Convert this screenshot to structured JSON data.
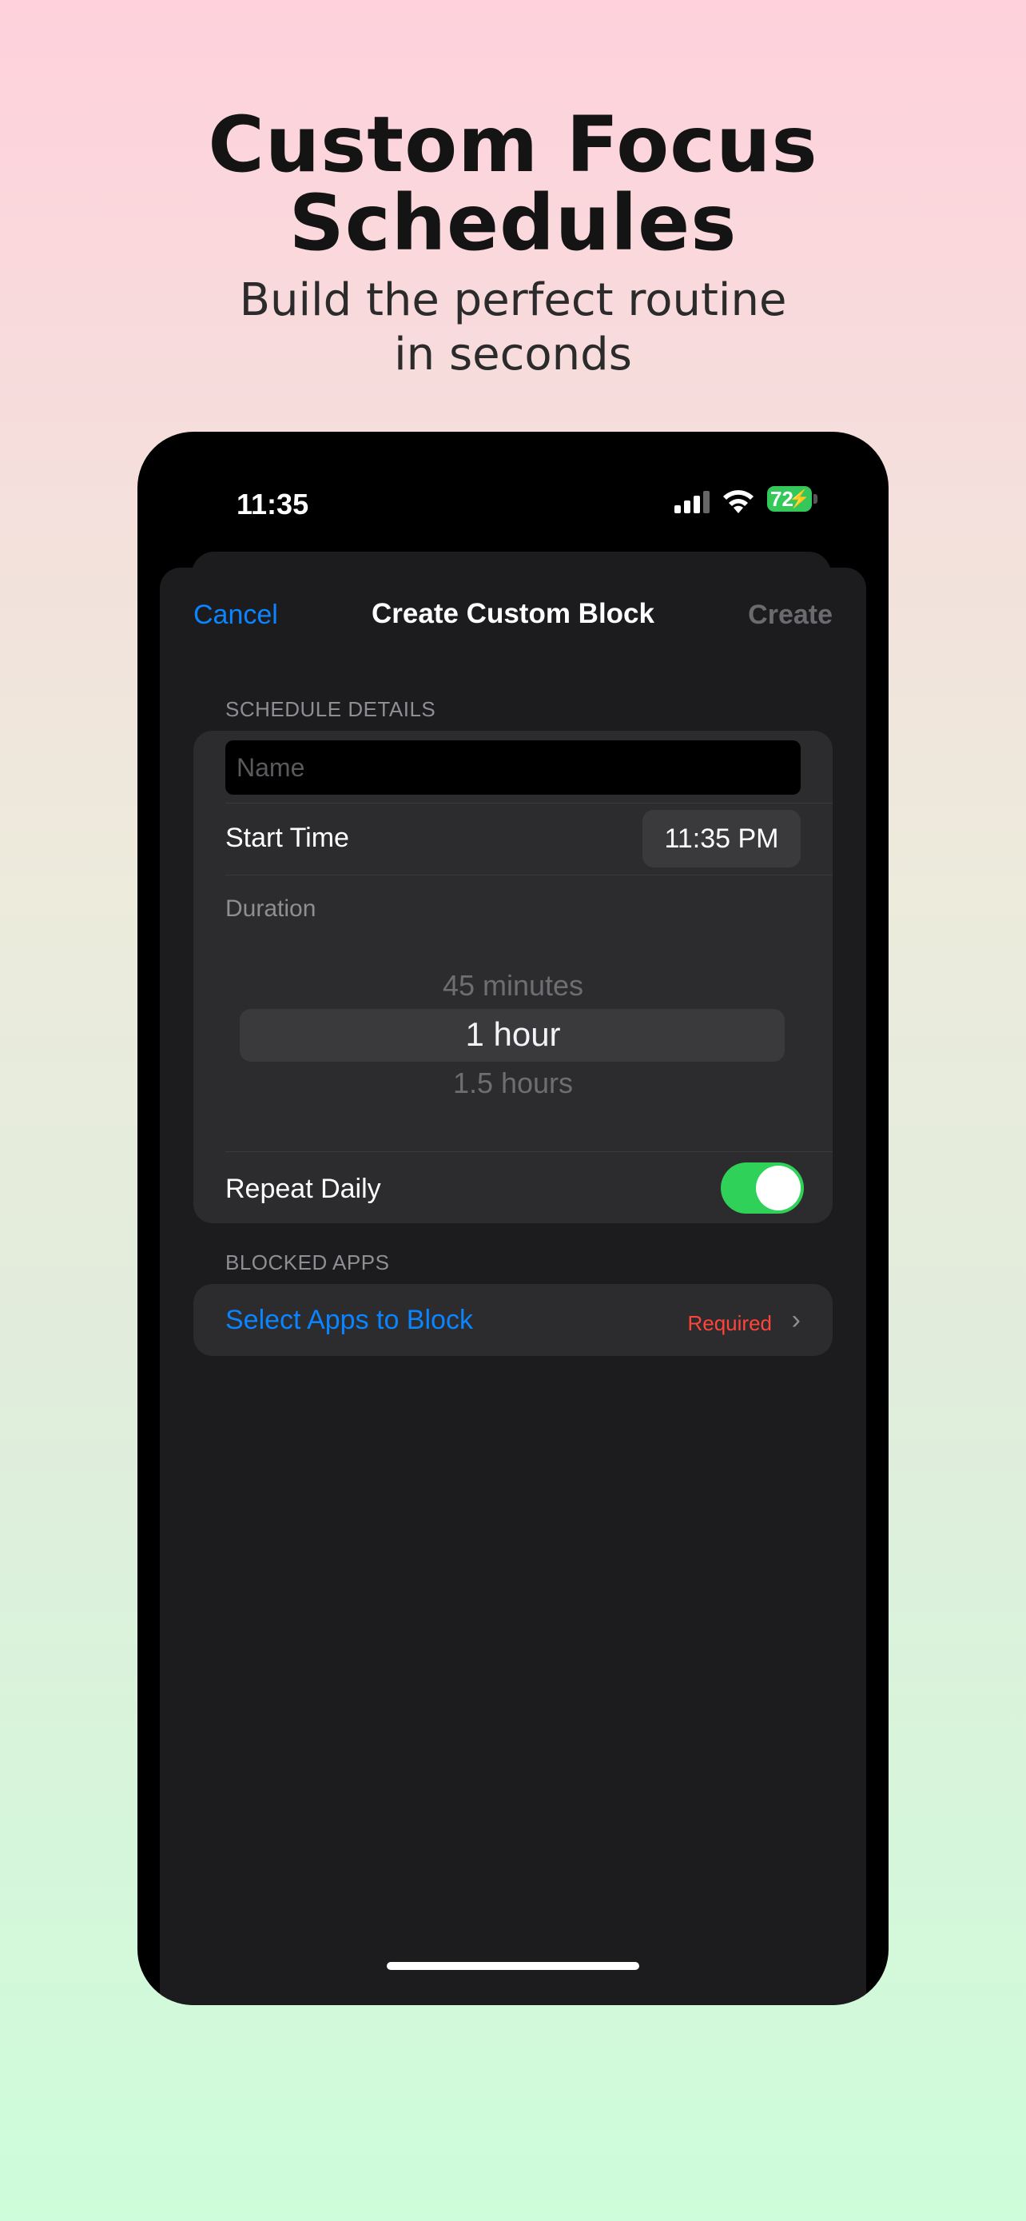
{
  "promo": {
    "headline_line1": "Custom Focus",
    "headline_line2": "Schedules",
    "subline_line1": "Build the perfect routine",
    "subline_line2": "in seconds"
  },
  "status_bar": {
    "time": "11:35",
    "battery": "72",
    "battery_color": "#34c759",
    "icons": [
      "signal-icon",
      "wifi-icon",
      "battery-icon",
      "charging-bolt-icon"
    ]
  },
  "nav": {
    "cancel_label": "Cancel",
    "title": "Create Custom Block",
    "create_label": "Create"
  },
  "schedule": {
    "section_label": "SCHEDULE DETAILS",
    "name_placeholder": "Name",
    "name_value": "",
    "start_time_label": "Start Time",
    "start_time_value": "11:35 PM",
    "duration_label": "Duration",
    "duration_options": [
      "45 minutes",
      "1 hour",
      "1.5 hours"
    ],
    "duration_selected": "1 hour",
    "repeat_label": "Repeat Daily",
    "repeat_on": true,
    "toggle_color": "#30d158"
  },
  "blocked_apps": {
    "section_label": "BLOCKED APPS",
    "select_label": "Select Apps to Block",
    "required_label": "Required"
  },
  "colors": {
    "accent": "#0a84ff",
    "required": "#ff453a",
    "sheet_bg": "#1c1c1e",
    "group_bg": "#2c2c2e"
  }
}
